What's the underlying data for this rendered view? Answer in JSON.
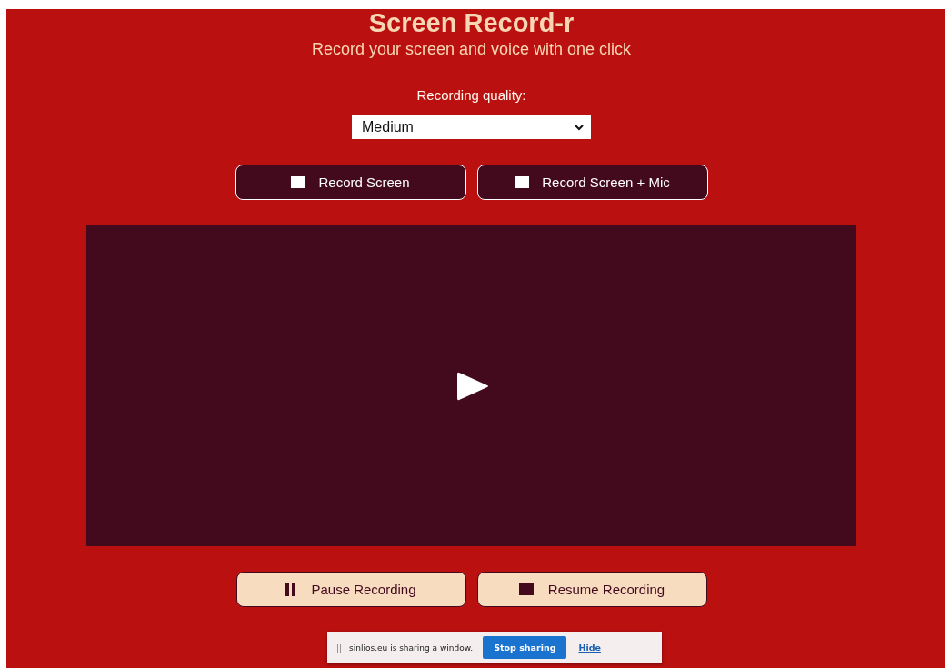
{
  "header": {
    "title": "Screen Record-r",
    "subtitle": "Record your screen and voice with one click"
  },
  "quality": {
    "label": "Recording quality:",
    "value": "Medium"
  },
  "record_buttons": [
    {
      "label": "Record Screen",
      "kind": "square"
    },
    {
      "label": "Record Screen + Mic",
      "kind": "square"
    }
  ],
  "video": {
    "kind": "player"
  },
  "control_buttons": [
    {
      "label": "Pause Recording",
      "kind": "pause"
    },
    {
      "label": "Resume Recording",
      "kind": "stop"
    }
  ],
  "sharing_bar": {
    "handle": "||",
    "message": "sinlios.eu is sharing a window.",
    "stop_button": "Stop sharing",
    "hide_link": "Hide"
  }
}
